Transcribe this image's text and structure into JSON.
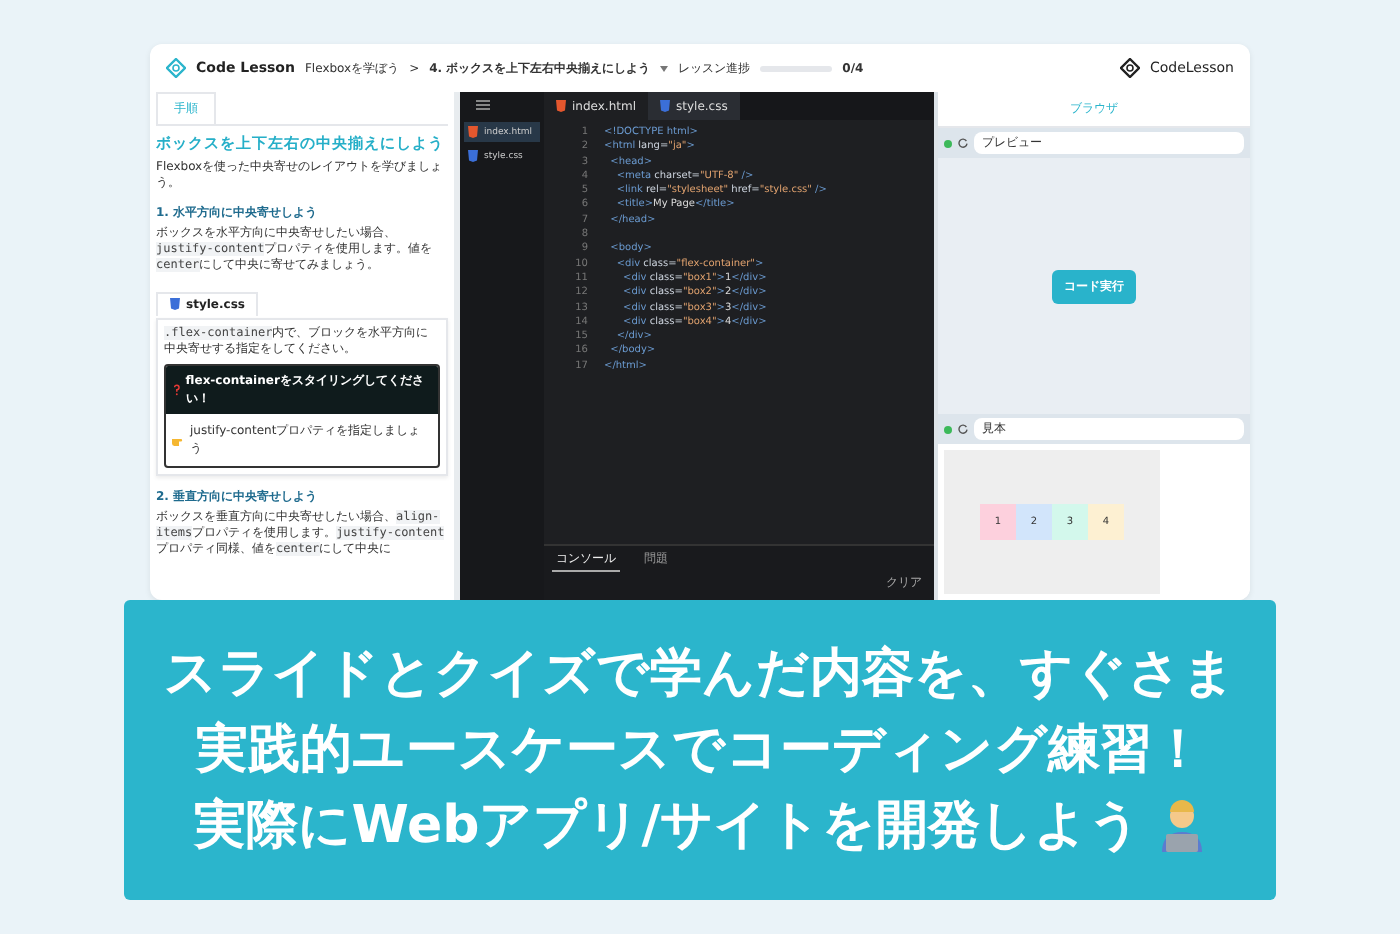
{
  "header": {
    "logo": "Code Lesson",
    "course": "Flexboxを学ぼう",
    "separator": ">",
    "lesson": "4. ボックスを上下左右中央揃えにしよう",
    "progress_label": "レッスン進捗",
    "progress": {
      "level": 0
    },
    "progress_text": "0/4",
    "brand": "CodeLesson"
  },
  "instructions": {
    "tabs": [
      {
        "label": "手順",
        "selected": true
      }
    ],
    "title": "ボックスを上下左右の中央揃えにしよう",
    "intro": "Flexboxを使った中央寄せのレイアウトを学びましょう。",
    "sections": [
      {
        "heading": "1. 水平方向に中央寄せしよう",
        "body": [
          {
            "kind": "text",
            "text": "ボックスを水平方向に中央寄せしたい場合、"
          },
          {
            "kind": "code",
            "text": "justify-content"
          },
          {
            "kind": "text",
            "text": "プロパティを使用します。値を"
          },
          {
            "kind": "code",
            "text": "center"
          },
          {
            "kind": "text",
            "text": "にして中央に寄せてみましょう。"
          }
        ],
        "task": {
          "file": "style.css",
          "body": [
            {
              "kind": "code",
              "text": ".flex-container"
            },
            {
              "kind": "text",
              "text": "内で、ブロックを水平方向に中央寄せする指定をしてください。"
            }
          ],
          "question": "flex-containerをスタイリングしてください！",
          "hint": "justify-contentプロパティを指定しましょう"
        }
      },
      {
        "heading": "2. 垂直方向に中央寄せしよう",
        "body": [
          {
            "kind": "text",
            "text": "ボックスを垂直方向に中央寄せしたい場合、"
          },
          {
            "kind": "code",
            "text": "align-items"
          },
          {
            "kind": "text",
            "text": "プロパティを使用します。"
          },
          {
            "kind": "code",
            "text": "justify-content"
          },
          {
            "kind": "text",
            "text": "プロパティ同様、値を"
          },
          {
            "kind": "code",
            "text": "center"
          },
          {
            "kind": "text",
            "text": "にして中央に"
          }
        ]
      }
    ]
  },
  "editor": {
    "files": [
      {
        "name": "index.html",
        "kind": "html",
        "selected": true
      },
      {
        "name": "style.css",
        "kind": "css",
        "selected": false
      }
    ],
    "tabs": [
      {
        "name": "index.html",
        "kind": "html",
        "selected": true
      },
      {
        "name": "style.css",
        "kind": "css",
        "selected": false
      }
    ],
    "lines": [
      {
        "number": "1",
        "tokens": [
          {
            "kind": "tag",
            "text": "<!DOCTYPE html>"
          }
        ]
      },
      {
        "number": "2",
        "tokens": [
          {
            "kind": "tag",
            "text": "<html "
          },
          {
            "kind": "attr",
            "text": "lang="
          },
          {
            "kind": "string",
            "text": "\"ja\""
          },
          {
            "kind": "tag",
            "text": ">"
          }
        ]
      },
      {
        "number": "3",
        "tokens": [
          {
            "kind": "tag",
            "text": "  <head>"
          }
        ]
      },
      {
        "number": "4",
        "tokens": [
          {
            "kind": "tag",
            "text": "    <meta "
          },
          {
            "kind": "attr",
            "text": "charset="
          },
          {
            "kind": "string",
            "text": "\"UTF-8\""
          },
          {
            "kind": "tag",
            "text": " />"
          }
        ]
      },
      {
        "number": "5",
        "tokens": [
          {
            "kind": "tag",
            "text": "    <link "
          },
          {
            "kind": "attr",
            "text": "rel="
          },
          {
            "kind": "string",
            "text": "\"stylesheet\""
          },
          {
            "kind": "attr",
            "text": " href="
          },
          {
            "kind": "string",
            "text": "\"style.css\""
          },
          {
            "kind": "tag",
            "text": " />"
          }
        ]
      },
      {
        "number": "6",
        "tokens": [
          {
            "kind": "tag",
            "text": "    <title>"
          },
          {
            "kind": "text",
            "text": "My Page"
          },
          {
            "kind": "tag",
            "text": "</title>"
          }
        ]
      },
      {
        "number": "7",
        "tokens": [
          {
            "kind": "tag",
            "text": "  </head>"
          }
        ]
      },
      {
        "number": "8"
      },
      {
        "number": "9",
        "tokens": [
          {
            "kind": "tag",
            "text": "  <body>"
          }
        ]
      },
      {
        "number": "10",
        "tokens": [
          {
            "kind": "tag",
            "text": "    <div "
          },
          {
            "kind": "attr",
            "text": "class="
          },
          {
            "kind": "string",
            "text": "\"flex-container\""
          },
          {
            "kind": "tag",
            "text": ">"
          }
        ]
      },
      {
        "number": "11",
        "tokens": [
          {
            "kind": "tag",
            "text": "      <div "
          },
          {
            "kind": "attr",
            "text": "class="
          },
          {
            "kind": "string",
            "text": "\"box1\""
          },
          {
            "kind": "tag",
            "text": ">"
          },
          {
            "kind": "text",
            "text": "1"
          },
          {
            "kind": "tag",
            "text": "</div>"
          }
        ]
      },
      {
        "number": "12",
        "tokens": [
          {
            "kind": "tag",
            "text": "      <div "
          },
          {
            "kind": "attr",
            "text": "class="
          },
          {
            "kind": "string",
            "text": "\"box2\""
          },
          {
            "kind": "tag",
            "text": ">"
          },
          {
            "kind": "text",
            "text": "2"
          },
          {
            "kind": "tag",
            "text": "</div>"
          }
        ]
      },
      {
        "number": "13",
        "tokens": [
          {
            "kind": "tag",
            "text": "      <div "
          },
          {
            "kind": "attr",
            "text": "class="
          },
          {
            "kind": "string",
            "text": "\"box3\""
          },
          {
            "kind": "tag",
            "text": ">"
          },
          {
            "kind": "text",
            "text": "3"
          },
          {
            "kind": "tag",
            "text": "</div>"
          }
        ]
      },
      {
        "number": "14",
        "tokens": [
          {
            "kind": "tag",
            "text": "      <div "
          },
          {
            "kind": "attr",
            "text": "class="
          },
          {
            "kind": "string",
            "text": "\"box4\""
          },
          {
            "kind": "tag",
            "text": ">"
          },
          {
            "kind": "text",
            "text": "4"
          },
          {
            "kind": "tag",
            "text": "</div>"
          }
        ]
      },
      {
        "number": "15",
        "tokens": [
          {
            "kind": "tag",
            "text": "    </div>"
          }
        ]
      },
      {
        "number": "16",
        "tokens": [
          {
            "kind": "tag",
            "text": "  </body>"
          }
        ]
      },
      {
        "number": "17",
        "tokens": [
          {
            "kind": "tag",
            "text": "</html>"
          }
        ]
      }
    ],
    "console_tabs": [
      {
        "label": "コンソール",
        "selected": true
      },
      {
        "label": "問題",
        "selected": false
      }
    ],
    "clear": "クリア"
  },
  "browser": {
    "title": "ブラウザ",
    "preview_address": "プレビュー",
    "run_button": "コード実行",
    "sample_address": "見本",
    "sample_boxes": [
      {
        "label": "1",
        "color": "#fdd0dd"
      },
      {
        "label": "2",
        "color": "#d2e5fb"
      },
      {
        "label": "3",
        "color": "#d3f8ec"
      },
      {
        "label": "4",
        "color": "#fdf0d2"
      }
    ]
  },
  "banner": {
    "lines": [
      "スライドとクイズで学んだ内容を、すぐさま",
      "実践的ユースケースでコーディング練習！",
      "実際にWebアプリ/サイトを開発しよう"
    ]
  }
}
